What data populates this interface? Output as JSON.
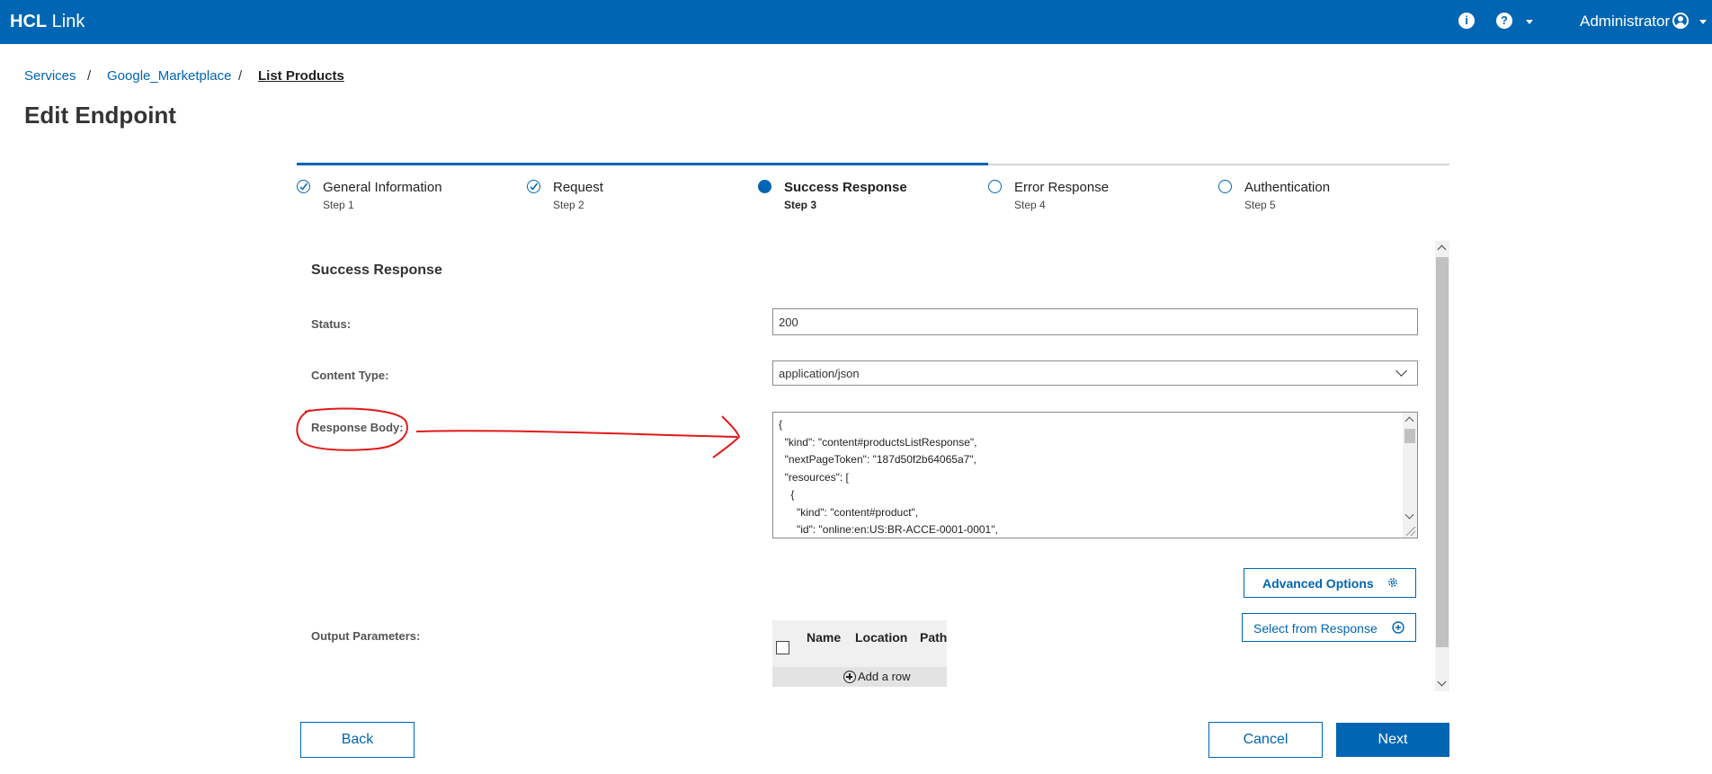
{
  "header": {
    "brand_bold": "HCL",
    "brand_rest": "Link",
    "info_icon": "info-icon",
    "help_icon": "help-icon",
    "user_name": "Administrator"
  },
  "breadcrumb": {
    "items": [
      "Services",
      "Google_Marketplace"
    ],
    "current": "List Products",
    "separator": "/"
  },
  "page_title": "Edit Endpoint",
  "stepper": {
    "steps": [
      {
        "label": "General Information",
        "sub": "Step 1",
        "state": "done"
      },
      {
        "label": "Request",
        "sub": "Step 2",
        "state": "done"
      },
      {
        "label": "Success Response",
        "sub": "Step 3",
        "state": "current"
      },
      {
        "label": "Error Response",
        "sub": "Step 4",
        "state": "todo"
      },
      {
        "label": "Authentication",
        "sub": "Step 5",
        "state": "todo"
      }
    ]
  },
  "form": {
    "section_title": "Success Response",
    "status_label": "Status:",
    "status_value": "200",
    "content_type_label": "Content Type:",
    "content_type_value": "application/json",
    "response_body_label": "Response Body:",
    "response_body_lines": [
      "{",
      "  \"kind\": \"content#productsListResponse\",",
      "  \"nextPageToken\": \"187d50f2b64065a7\",",
      "  \"resources\": [",
      "    {",
      "      \"kind\": \"content#product\",",
      "      \"id\": \"online:en:US:BR-ACCE-0001-0001\","
    ],
    "advanced_options_label": "Advanced Options",
    "select_from_response_label": "Select from Response",
    "output_params_label": "Output Parameters:",
    "output_table": {
      "columns": [
        "Name",
        "Location",
        "Path"
      ],
      "add_row_label": "Add a row"
    }
  },
  "footer": {
    "back_label": "Back",
    "cancel_label": "Cancel",
    "next_label": "Next"
  },
  "colors": {
    "brand": "#0065b3",
    "annotation": "#e11a1a"
  }
}
